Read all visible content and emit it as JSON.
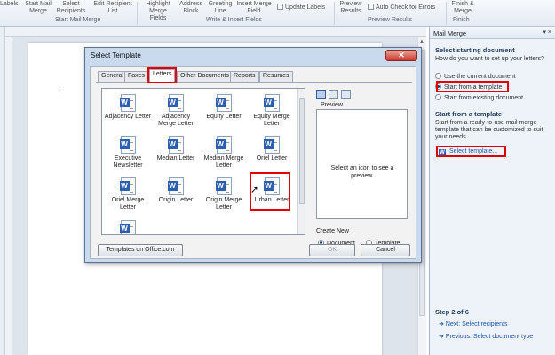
{
  "ribbon": {
    "labels_btn": "Labels",
    "start_mail_merge": "Start Mail Merge",
    "select_recipients": "Select Recipients",
    "edit_recipient_list": "Edit Recipient List",
    "highlight_merge_fields": "Highlight Merge Fields",
    "address_block": "Address Block",
    "greeting_line": "Greeting Line",
    "insert_merge_field": "Insert Merge Field",
    "update_labels": "Update Labels",
    "preview_results": "Preview Results",
    "auto_check_errors": "Auto Check for Errors",
    "finish_merge": "Finish & Merge",
    "group_start_mail_merge": "Start Mail Merge",
    "group_write_insert": "Write & Insert Fields",
    "group_preview": "Preview Results",
    "group_finish": "Finish"
  },
  "pane": {
    "title": "Mail Merge",
    "section1_heading": "Select starting document",
    "question": "How do you want to set up your letters?",
    "options": [
      "Use the current document",
      "Start from a template",
      "Start from existing document"
    ],
    "selected_option": "Start from a template",
    "section2_heading": "Start from a template",
    "description": "Start from a ready-to-use mail merge template that can be customized to suit your needs.",
    "select_template_link": "Select template...",
    "step": "Step 2 of 6",
    "next_link": "Next: Select recipients",
    "previous_link": "Previous: Select document type"
  },
  "dialog": {
    "title": "Select Template",
    "tabs": [
      "General",
      "Faxes",
      "Letters",
      "Other Documents",
      "Reports",
      "Resumes"
    ],
    "active_tab": "Letters",
    "templates": [
      "Adjacency Letter",
      "Adjacency Merge Letter",
      "Equity Letter",
      "Equity Merge Letter",
      "Executive Newsletter",
      "Median Letter",
      "Median Merge Letter",
      "Oriel Letter",
      "Oriel Merge Letter",
      "Origin Letter",
      "Origin Merge Letter",
      "Urban Letter"
    ],
    "selected_template": "Urban Letter",
    "preview_label": "Preview",
    "preview_message": "Select an icon to see a preview.",
    "create_new_label": "Create New",
    "create_options": [
      "Document",
      "Template"
    ],
    "create_selected": "Document",
    "templates_online_button": "Templates on Office.com",
    "ok_button": "OK",
    "cancel_button": "Cancel"
  },
  "colors": {
    "highlight_box": "#e20000",
    "word_blue": "#2c5fae",
    "link_blue": "#1d52a8"
  }
}
